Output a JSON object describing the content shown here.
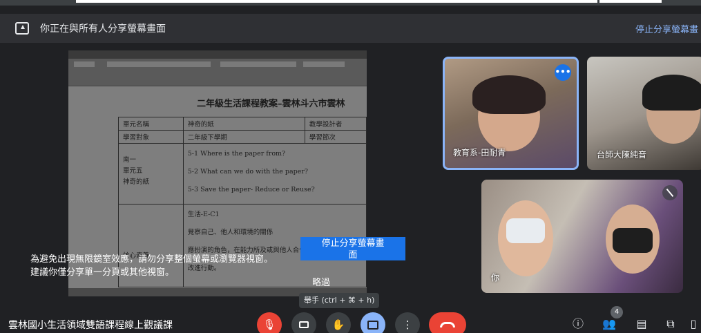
{
  "share_bar": {
    "message": "你正在與所有人分享螢幕畫面",
    "stop_link": "停止分享螢幕畫"
  },
  "document": {
    "title": "二年級生活課程教案–雲林斗六市雲林",
    "rows": [
      [
        "單元名稱",
        "神奇的紙",
        "教學設計者"
      ],
      [
        "學習對象",
        "二年級下學期",
        "學習節次"
      ]
    ],
    "unit_labels": [
      "南一",
      "單元五",
      "神奇的紙"
    ],
    "unit_items": [
      "5-1 Where is the paper from?",
      "5-2 What can we do with the paper?",
      "5-3 Save the paper- Reduce or Reuse?"
    ],
    "competency_code": "生活-E-C1",
    "competency_lines": [
      "覺察自己、他人和環境的關係",
      "應扮演的角色，在能力所及或與他人合作的情況",
      "改進行動。"
    ],
    "competency_label": "核心素養"
  },
  "participants": [
    {
      "name": "教育系-田耐青",
      "more_icon": "more-horiz-icon"
    },
    {
      "name": "台師大陳純音"
    },
    {
      "name": "你",
      "mic_icon": "mic-off-icon"
    }
  ],
  "warning": {
    "line1": "為避免出現無限鏡室效應，請勿分享整個螢幕或瀏覽器視窗。",
    "line2": "建議你僅分享單一分頁或其他視窗。"
  },
  "stop_button": {
    "line1": "停止分享螢幕畫",
    "line2": "面"
  },
  "skip_label": "略過",
  "tooltip": "舉手 (ctrl + ⌘ + h)",
  "meeting_title": "雲林國小生活領域雙語課程線上觀議課",
  "controls": {
    "mic": "mic-off-icon",
    "camera": "videocam-icon",
    "hand": "raise-hand-icon",
    "present": "present-screen-icon",
    "more": "more-vert-icon",
    "hangup": "call-end-icon"
  },
  "people_count": "4",
  "colors": {
    "accent_blue": "#8ab4f8",
    "button_blue": "#1a73e8",
    "red": "#ea4335"
  }
}
